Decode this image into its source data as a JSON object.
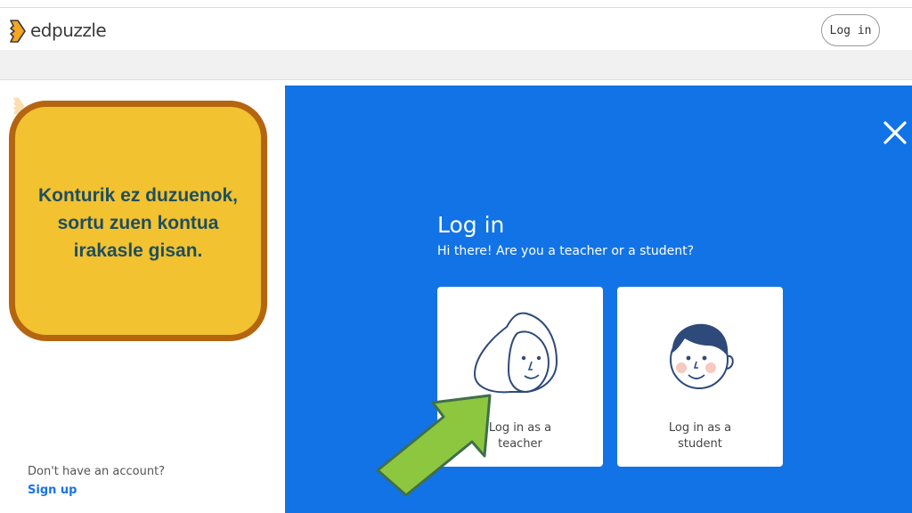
{
  "header": {
    "brand": "edpuzzle",
    "login_button": "Log in"
  },
  "left_panel": {
    "no_account_text": "Don't have an account?",
    "signup_link": "Sign up"
  },
  "callout": {
    "text": "Konturik ez duzuenok,\nsortu zuen kontua\nirakasle gisan."
  },
  "modal": {
    "title": "Log in",
    "subtitle": "Hi there! Are you a teacher or a student?",
    "teacher_card_label": "Log in as a\nteacher",
    "student_card_label": "Log in as a\nstudent"
  },
  "colors": {
    "brand_orange": "#f5a623",
    "modal_blue": "#1273e6",
    "callout_fill": "#f2c230",
    "callout_border": "#b5650f",
    "arrow_green": "#8dc63f"
  }
}
